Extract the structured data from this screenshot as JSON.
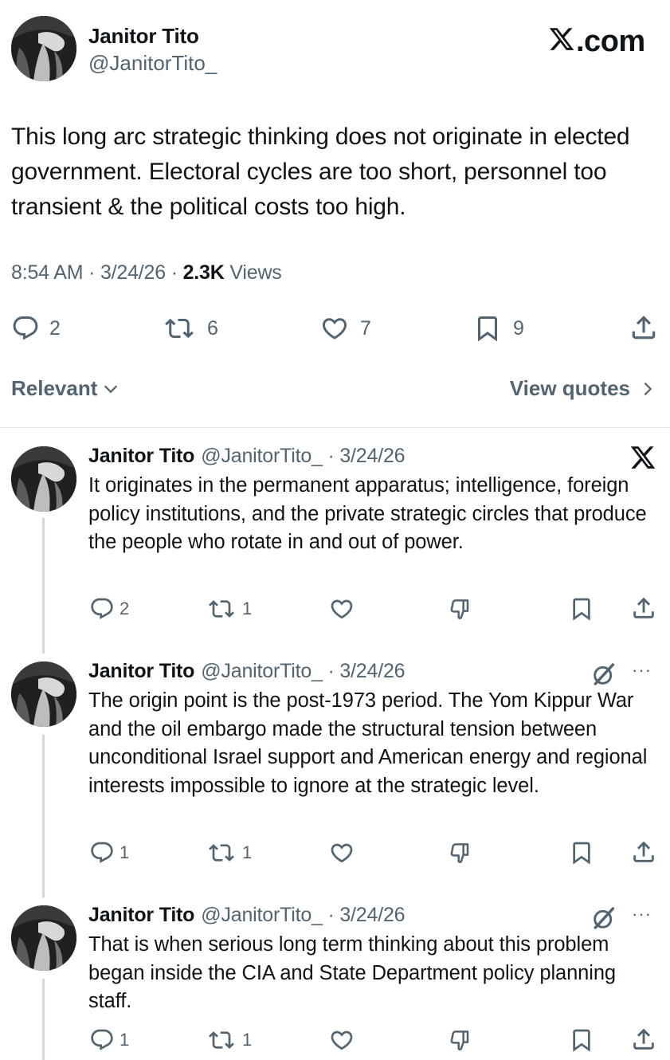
{
  "header": {
    "brand": ".com"
  },
  "main_tweet": {
    "author_name": "Janitor Tito",
    "author_handle": "@JanitorTito_",
    "text": "This long arc strategic thinking does not originate in elected government. Electoral cycles are too short, personnel too transient & the political costs too high.",
    "time": "8:54 AM",
    "date": "3/24/26",
    "views_count": "2.3K",
    "views_label": "Views",
    "replies": "2",
    "reposts": "6",
    "likes": "7",
    "bookmarks": "9"
  },
  "sort": {
    "label": "Relevant"
  },
  "quotes": {
    "label": "View quotes"
  },
  "replies": [
    {
      "author_name": "Janitor Tito",
      "author_handle": "@JanitorTito_ · 3/24/26",
      "text": "It originates in the permanent apparatus; intelligence, foreign policy institutions, and the private strategic circles that produce the people who rotate in and out of power.",
      "replies": "2",
      "reposts": "1",
      "corner_icon": "x-logo-icon"
    },
    {
      "author_name": "Janitor Tito",
      "author_handle": "@JanitorTito_ · 3/24/26",
      "text": "The origin point is the post-1973 period. The Yom Kippur War and the oil embargo made the structural tension between unconditional Israel support and American energy and regional interests impossible to ignore at the strategic level.",
      "replies": "1",
      "reposts": "1",
      "corner_icon": "grok-icon",
      "more": "···"
    },
    {
      "author_name": "Janitor Tito",
      "author_handle": "@JanitorTito_ · 3/24/26",
      "text": "That is when serious long term thinking about this problem began inside the CIA and State Department policy planning staff.",
      "replies": "1",
      "reposts": "1",
      "corner_icon": "grok-icon",
      "more": "···"
    }
  ],
  "colors": {
    "text": "#0f1419",
    "secondary": "#536471",
    "thread_line": "#cfd9de",
    "divider": "#e1e4e7"
  }
}
